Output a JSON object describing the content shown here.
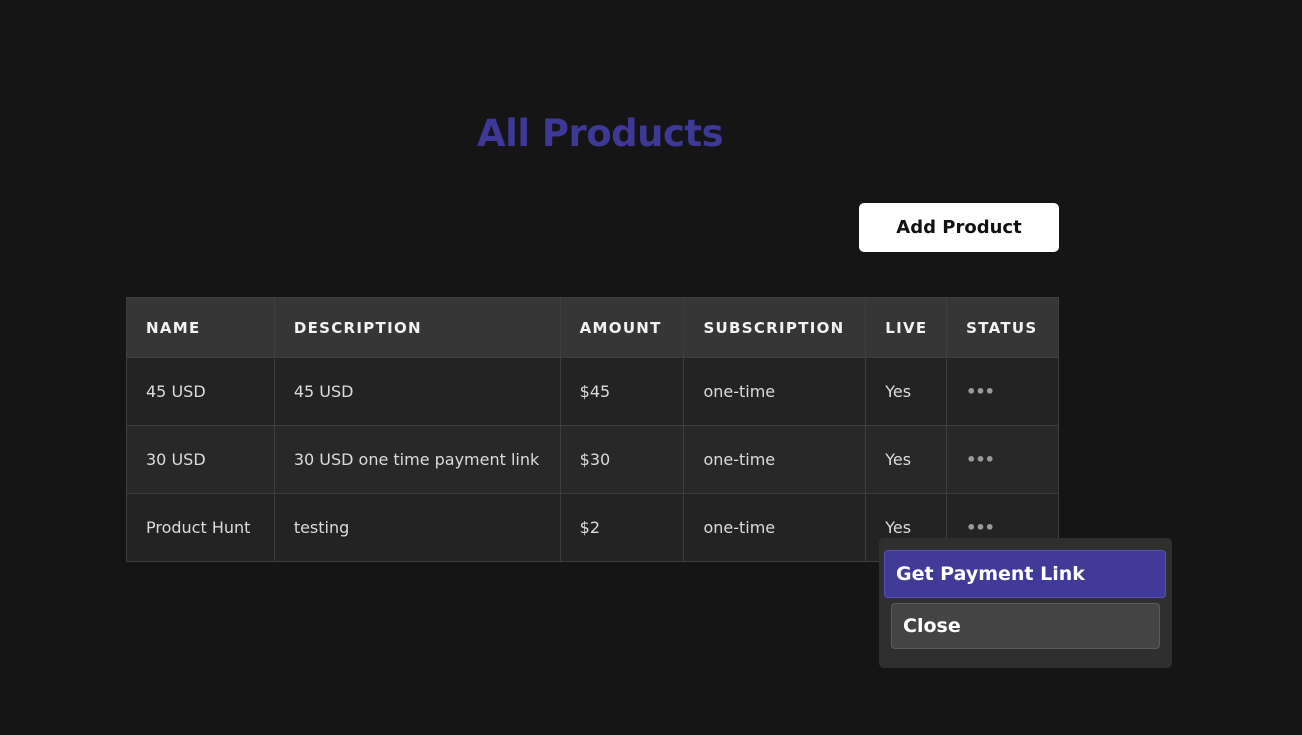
{
  "page": {
    "title": "All Products"
  },
  "toolbar": {
    "add_product_label": "Add Product"
  },
  "table": {
    "columns": [
      "NAME",
      "DESCRIPTION",
      "AMOUNT",
      "SUBSCRIPTION",
      "LIVE",
      "STATUS"
    ],
    "rows": [
      {
        "name": "45 USD",
        "description": "45 USD",
        "amount": "$45",
        "subscription": "one-time",
        "live": "Yes",
        "status": "•••"
      },
      {
        "name": "30 USD",
        "description": "30 USD one time payment link",
        "amount": "$30",
        "subscription": "one-time",
        "live": "Yes",
        "status": "•••"
      },
      {
        "name": "Product Hunt",
        "description": "testing",
        "amount": "$2",
        "subscription": "one-time",
        "live": "Yes",
        "status": "•••"
      }
    ]
  },
  "menu": {
    "get_payment_link_label": "Get Payment Link",
    "close_label": "Close"
  },
  "colors": {
    "background": "#151515",
    "accent": "#3e3896",
    "menu_highlight": "#413a96"
  },
  "icons": {
    "status_menu": "more-horizontal-icon"
  }
}
